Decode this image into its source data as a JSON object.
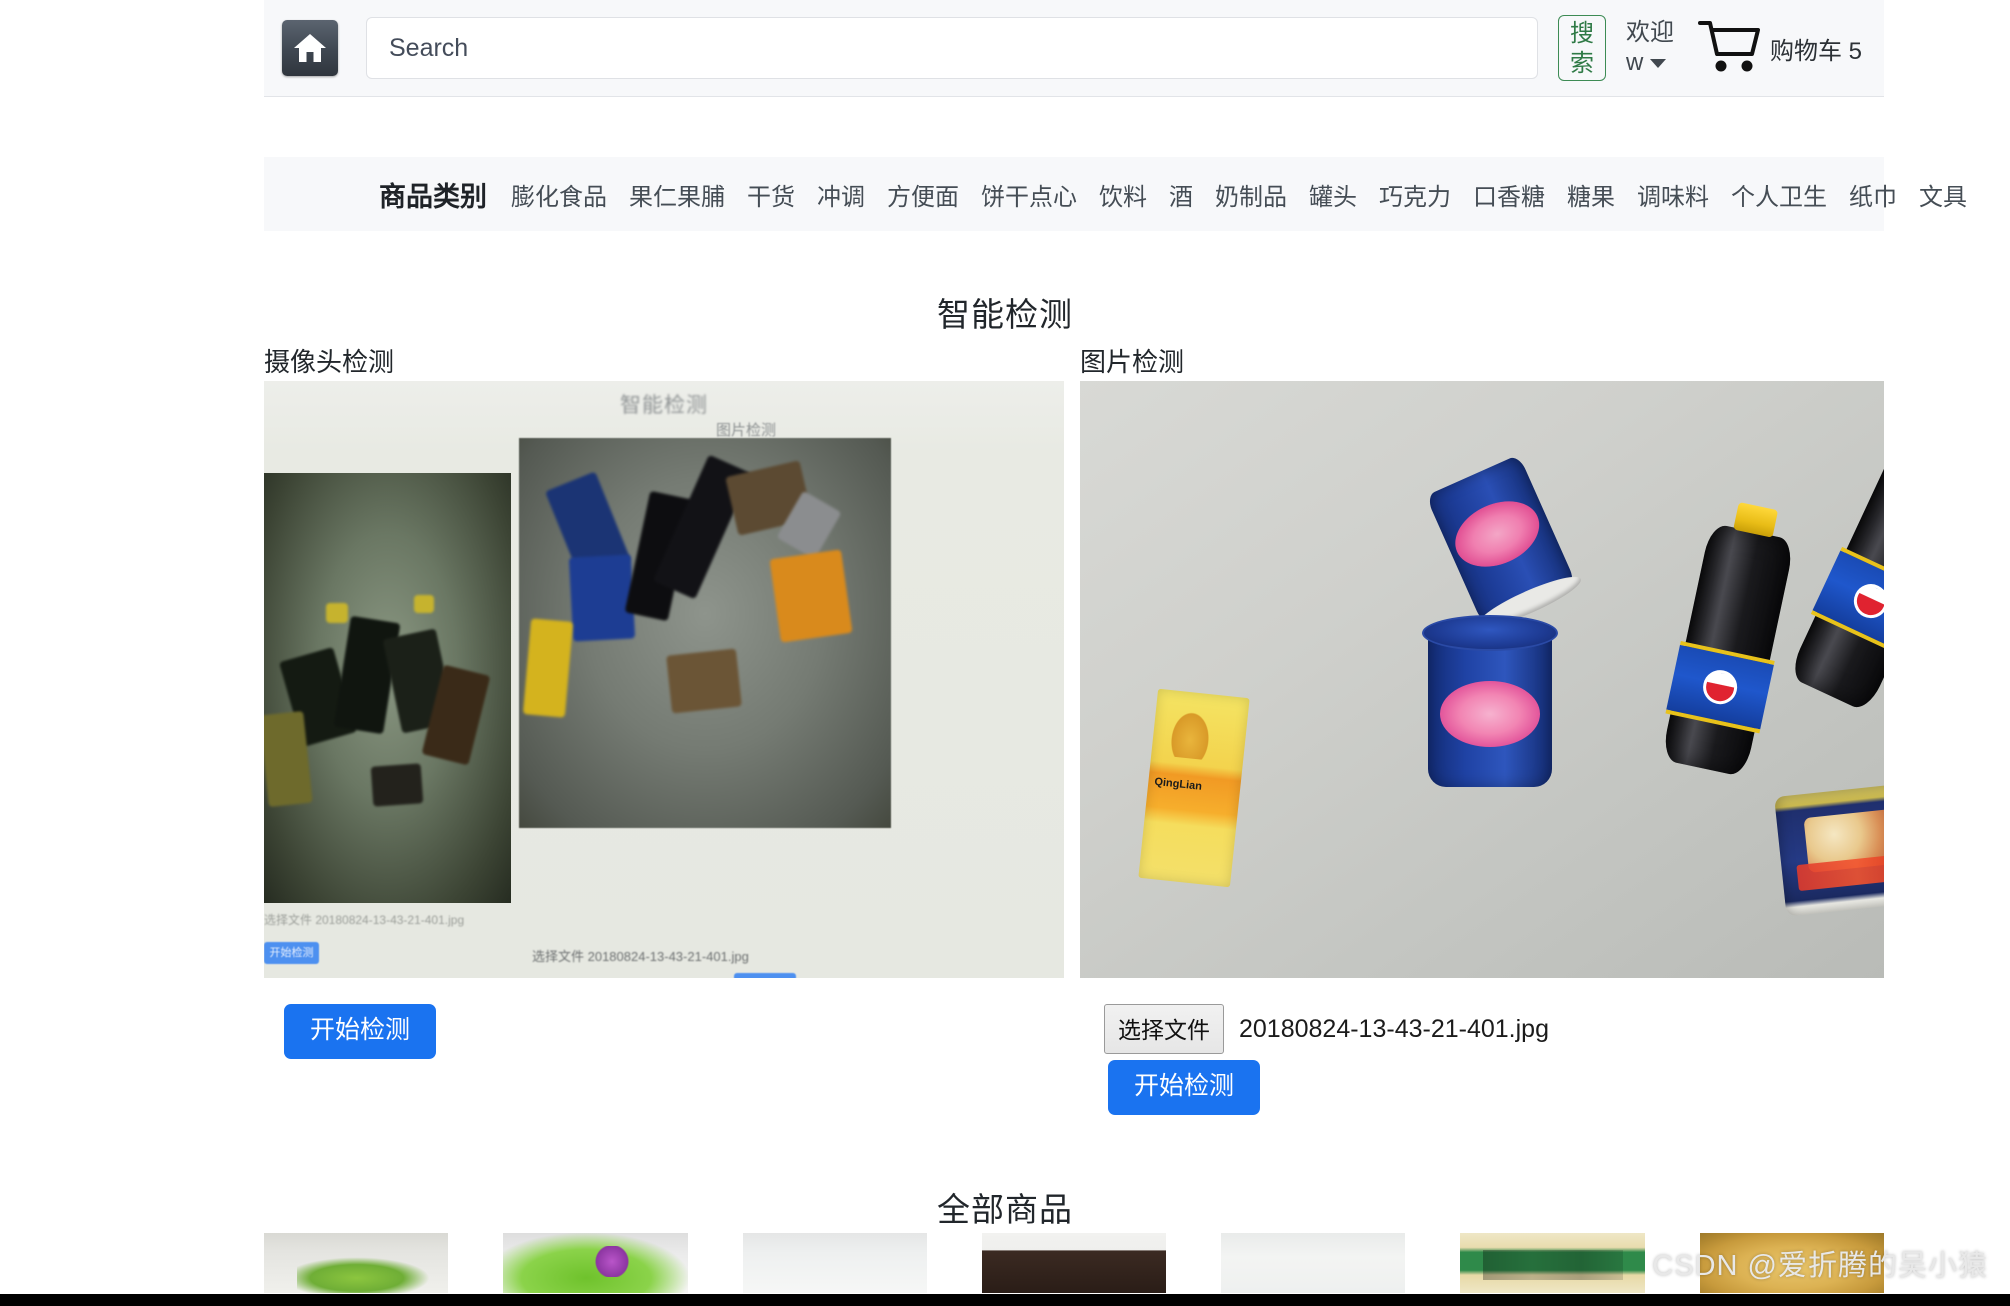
{
  "header": {
    "home_icon": "home-icon",
    "search": {
      "value": "",
      "placeholder": "Search"
    },
    "search_button_label": "搜索",
    "welcome_label": "欢迎",
    "user_name": "w",
    "dropdown_icon": "chevron-down-icon",
    "cart_icon": "shopping-cart-icon",
    "cart_label": "购物车 5"
  },
  "nav": {
    "title": "商品类别",
    "items": [
      {
        "label": "膨化食品"
      },
      {
        "label": "果仁果脯"
      },
      {
        "label": "干货"
      },
      {
        "label": "冲调"
      },
      {
        "label": "方便面"
      },
      {
        "label": "饼干点心"
      },
      {
        "label": "饮料"
      },
      {
        "label": "酒"
      },
      {
        "label": "奶制品"
      },
      {
        "label": "罐头"
      },
      {
        "label": "巧克力"
      },
      {
        "label": "口香糖"
      },
      {
        "label": "糖果"
      },
      {
        "label": "调味料"
      },
      {
        "label": "个人卫生"
      },
      {
        "label": "纸巾"
      },
      {
        "label": "文具"
      }
    ]
  },
  "main": {
    "page_title": "智能检测",
    "camera_panel": {
      "label": "摄像头检测",
      "start_button_label": "开始检测",
      "preview_overlay": {
        "title": "智能检测",
        "sub_label": "图片检测",
        "file_caption": "选择文件   20180824-13-43-21-401.jpg",
        "small_caption": "选择文件  20180824-13-43-21-401.jpg",
        "button_label": "开始检测"
      }
    },
    "image_panel": {
      "label": "图片检测",
      "file_button_label": "选择文件",
      "file_name": "20180824-13-43-21-401.jpg",
      "start_button_label": "开始检测"
    }
  },
  "products_section": {
    "title": "全部商品",
    "thumbnails": [
      {
        "name": "product-thumb-1"
      },
      {
        "name": "product-thumb-2"
      },
      {
        "name": "product-thumb-3"
      },
      {
        "name": "product-thumb-4"
      },
      {
        "name": "product-thumb-5"
      },
      {
        "name": "product-thumb-6"
      },
      {
        "name": "product-thumb-7"
      }
    ]
  },
  "watermark": "CSDN @爱折腾的吴小猿",
  "colors": {
    "primary_button": "#1a73f0",
    "search_button_border": "#3d8b54",
    "header_bg": "#f7f8fa"
  }
}
